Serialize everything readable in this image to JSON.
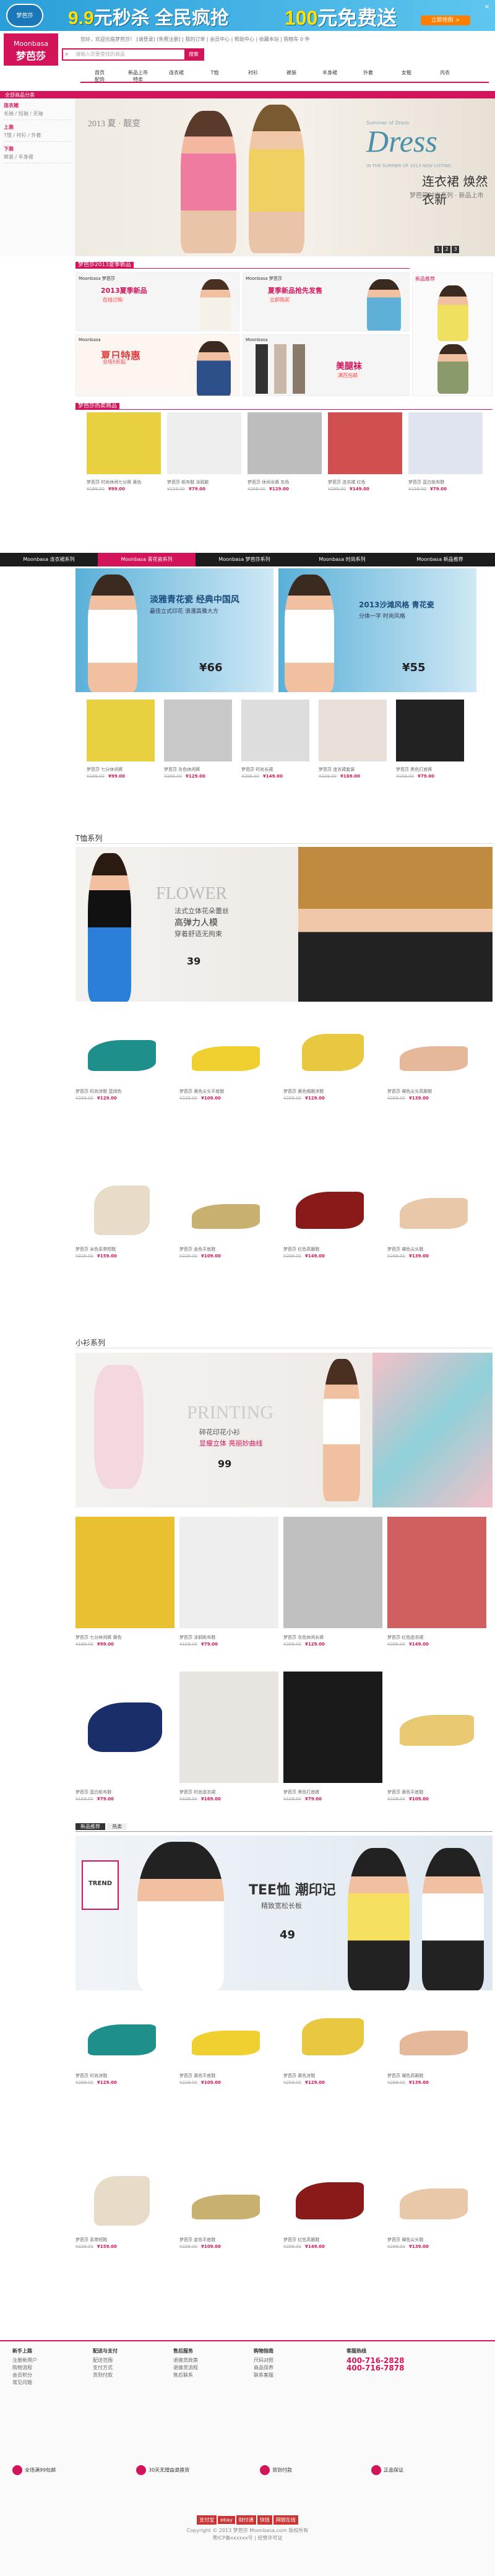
{
  "top_banner": {
    "logo": "梦芭莎",
    "promo1_price": "9.9",
    "promo1_text": "元秒杀 全民疯抢",
    "promo2_price": "100",
    "promo2_text": "元免费送",
    "cta": "立即抢购 >",
    "close": "×"
  },
  "header": {
    "brand_en": "Moonbasa",
    "brand_cn": "梦芭莎",
    "brand_tag": "MOONBASA",
    "links": "您好，欢迎光临梦芭莎！ [请登录] [免费注册]  |  我的订单  |  会员中心  |  帮助中心  |  收藏本站  |  购物车 0 件",
    "search_placeholder": "请输入您要查找的商品",
    "search_btn": "搜索",
    "nav": [
      "首页",
      "新品上市",
      "连衣裙",
      "T恤",
      "衬衫",
      "裤装",
      "半身裙",
      "外套",
      "女鞋",
      "内衣",
      "配饰",
      "特卖"
    ]
  },
  "pinkbar": "全部商品分类",
  "sidebar": [
    {
      "h": "连衣裙",
      "sub": "长袖 / 短袖 / 无袖"
    },
    {
      "h": "上装",
      "sub": "T恤 / 衬衫 / 外套"
    },
    {
      "h": "下装",
      "sub": "裤装 / 半身裙"
    }
  ],
  "hero": {
    "year": "2013 夏 · 靓变",
    "dress": "Dress",
    "en_sub": "Summer of Dress",
    "en_sub2": "IN THE SUMMER OF 2013 NEW LISTING",
    "cn_title": "连衣裙 焕然衣新",
    "cn_sub": "梦芭莎时尚系列 · 新品上市",
    "pages": [
      "1",
      "2",
      "3"
    ]
  },
  "section1_title": "梦芭莎2013夏季新品",
  "promos": [
    {
      "label": "Moonbasa 梦芭莎",
      "main": "2013夏季新品",
      "price": "在线订购"
    },
    {
      "label": "Moonbasa 梦芭莎",
      "main": "夏季新品抢先发售",
      "price": "立即购买"
    },
    {
      "label": "Moonbasa",
      "main": "夏日特惠",
      "price": "全场5折起"
    },
    {
      "label": "Moonbasa",
      "main": "美腿袜",
      "price": "满百包邮"
    }
  ],
  "side_promo": "新品推荐",
  "row1_title": "梦芭莎热卖商品",
  "products_row1": [
    {
      "name": "梦芭莎 时尚休闲七分裤 黄色",
      "orig": "¥199.00",
      "price": "¥99.00"
    },
    {
      "name": "梦芭莎 帆布鞋 涂鸦款",
      "orig": "¥159.00",
      "price": "¥79.00"
    },
    {
      "name": "梦芭莎 休闲长裤 灰色",
      "orig": "¥269.00",
      "price": "¥129.00"
    },
    {
      "name": "梦芭莎 连衣裙 红色",
      "orig": "¥299.00",
      "price": "¥149.00"
    },
    {
      "name": "梦芭莎 蓝白帆布鞋",
      "orig": "¥159.00",
      "price": "¥79.00"
    }
  ],
  "tabs": [
    "Moonbasa 连衣裙系列",
    "Moonbasa 青花瓷系列",
    "Moonbasa 梦芭莎系列",
    "Moonbasa 时尚系列",
    "Moonbasa 新品推荐"
  ],
  "banner2": {
    "left_title": "淡雅青花瓷 经典中国风",
    "left_sub": "最佳立式印花 浪漫高雅大方",
    "left_price": "¥66",
    "right_title": "2013沙滩风格 青花瓷",
    "right_sub": "分体一字 时尚风格",
    "right_price": "¥55"
  },
  "products_row2": [
    {
      "name": "梦芭莎 七分休闲裤",
      "orig": "¥199.00",
      "price": "¥99.00"
    },
    {
      "name": "梦芭莎 灰色休闲裤",
      "orig": "¥269.00",
      "price": "¥129.00"
    },
    {
      "name": "梦芭莎 时尚长裙",
      "orig": "¥299.00",
      "price": "¥149.00"
    },
    {
      "name": "梦芭莎 连衣裙套装",
      "orig": "¥329.00",
      "price": "¥169.00"
    },
    {
      "name": "梦芭莎 黑色打底裤",
      "orig": "¥159.00",
      "price": "¥79.00"
    }
  ],
  "tshirt_cat": "T恤系列",
  "tshirt_banner": {
    "en": "FLOWER",
    "cn1": "法式立体花朵蕾丝",
    "cn2": "高弹力人模",
    "cn3": "穿着舒适无拘束",
    "price": "39"
  },
  "shoes1": [
    {
      "name": "梦芭莎 时尚凉鞋 蓝绿色",
      "orig": "¥269.00",
      "price": "¥129.00"
    },
    {
      "name": "梦芭莎 黄色尖头平底鞋",
      "orig": "¥229.00",
      "price": "¥109.00"
    },
    {
      "name": "梦芭莎 黄色细跟凉鞋",
      "orig": "¥259.00",
      "price": "¥129.00"
    },
    {
      "name": "梦芭莎 裸色尖头高跟鞋",
      "orig": "¥289.00",
      "price": "¥139.00"
    },
    {
      "name": "梦芭莎 米色系带短靴",
      "orig": "¥329.00",
      "price": "¥159.00"
    },
    {
      "name": "梦芭莎 金色平底鞋",
      "orig": "¥229.00",
      "price": "¥109.00"
    },
    {
      "name": "梦芭莎 红色高跟鞋",
      "orig": "¥299.00",
      "price": "¥149.00"
    },
    {
      "name": "梦芭莎 裸色尖头鞋",
      "orig": "¥289.00",
      "price": "¥139.00"
    }
  ],
  "shirt_cat": "小衫系列",
  "shirt_banner": {
    "en": "PRINTING",
    "cn1": "碎花印花小衫",
    "cn2": "显瘦立体 亮丽妙曲线",
    "price": "99"
  },
  "products_row3": [
    {
      "name": "梦芭莎 七分休闲裤 黄色",
      "orig": "¥199.00",
      "price": "¥99.00"
    },
    {
      "name": "梦芭莎 涂鸦帆布鞋",
      "orig": "¥159.00",
      "price": "¥79.00"
    },
    {
      "name": "梦芭莎 灰色休闲长裤",
      "orig": "¥269.00",
      "price": "¥129.00"
    },
    {
      "name": "梦芭莎 红色连衣裙",
      "orig": "¥299.00",
      "price": "¥149.00"
    }
  ],
  "products_row4": [
    {
      "name": "梦芭莎 蓝白帆布鞋",
      "orig": "¥159.00",
      "price": "¥79.00"
    },
    {
      "name": "梦芭莎 时尚连衣裙",
      "orig": "¥329.00",
      "price": "¥169.00"
    },
    {
      "name": "梦芭莎 黑色打底裤",
      "orig": "¥159.00",
      "price": "¥79.00"
    },
    {
      "name": "梦芭莎 黄色平底鞋",
      "orig": "¥229.00",
      "price": "¥109.00"
    }
  ],
  "tee_tabs": [
    "新品推荐",
    "热卖"
  ],
  "tee_banner": {
    "tag": "TREND",
    "title": "TEE恤 潮印记",
    "sub": "精致宽松长板",
    "price": "49"
  },
  "shoes2": [
    {
      "name": "梦芭莎 时尚凉鞋",
      "orig": "¥269.00",
      "price": "¥129.00"
    },
    {
      "name": "梦芭莎 黄色平底鞋",
      "orig": "¥229.00",
      "price": "¥109.00"
    },
    {
      "name": "梦芭莎 黄色凉鞋",
      "orig": "¥259.00",
      "price": "¥129.00"
    },
    {
      "name": "梦芭莎 裸色高跟鞋",
      "orig": "¥289.00",
      "price": "¥139.00"
    },
    {
      "name": "梦芭莎 系带短靴",
      "orig": "¥329.00",
      "price": "¥159.00"
    },
    {
      "name": "梦芭莎 金色平底鞋",
      "orig": "¥229.00",
      "price": "¥109.00"
    },
    {
      "name": "梦芭莎 红色高跟鞋",
      "orig": "¥299.00",
      "price": "¥149.00"
    },
    {
      "name": "梦芭莎 裸色尖头鞋",
      "orig": "¥289.00",
      "price": "¥139.00"
    }
  ],
  "footer": {
    "cols": [
      {
        "h": "新手上路",
        "items": [
          "注册新用户",
          "购物流程",
          "会员积分",
          "常见问题"
        ]
      },
      {
        "h": "配送与支付",
        "items": [
          "配送范围",
          "支付方式",
          "货到付款"
        ]
      },
      {
        "h": "售后服务",
        "items": [
          "退换货政策",
          "退换货流程",
          "售后联系"
        ]
      },
      {
        "h": "购物指南",
        "items": [
          "尺码对照",
          "商品保养",
          "联系客服"
        ]
      }
    ],
    "hotline_label": "客服热线",
    "hotline1": "400-716-2828",
    "hotline2": "400-716-7878",
    "promises": [
      "全场满99包邮",
      "30天无理由退换货",
      "货到付款",
      "正品保证"
    ],
    "badges": [
      "支付宝",
      "ebay",
      "财付通",
      "快钱",
      "网银在线"
    ],
    "copy1": "Copyright © 2013 梦芭莎 Moonbasa.com 版权所有",
    "copy2": "粤ICP备xxxxxx号 | 经营许可证"
  }
}
